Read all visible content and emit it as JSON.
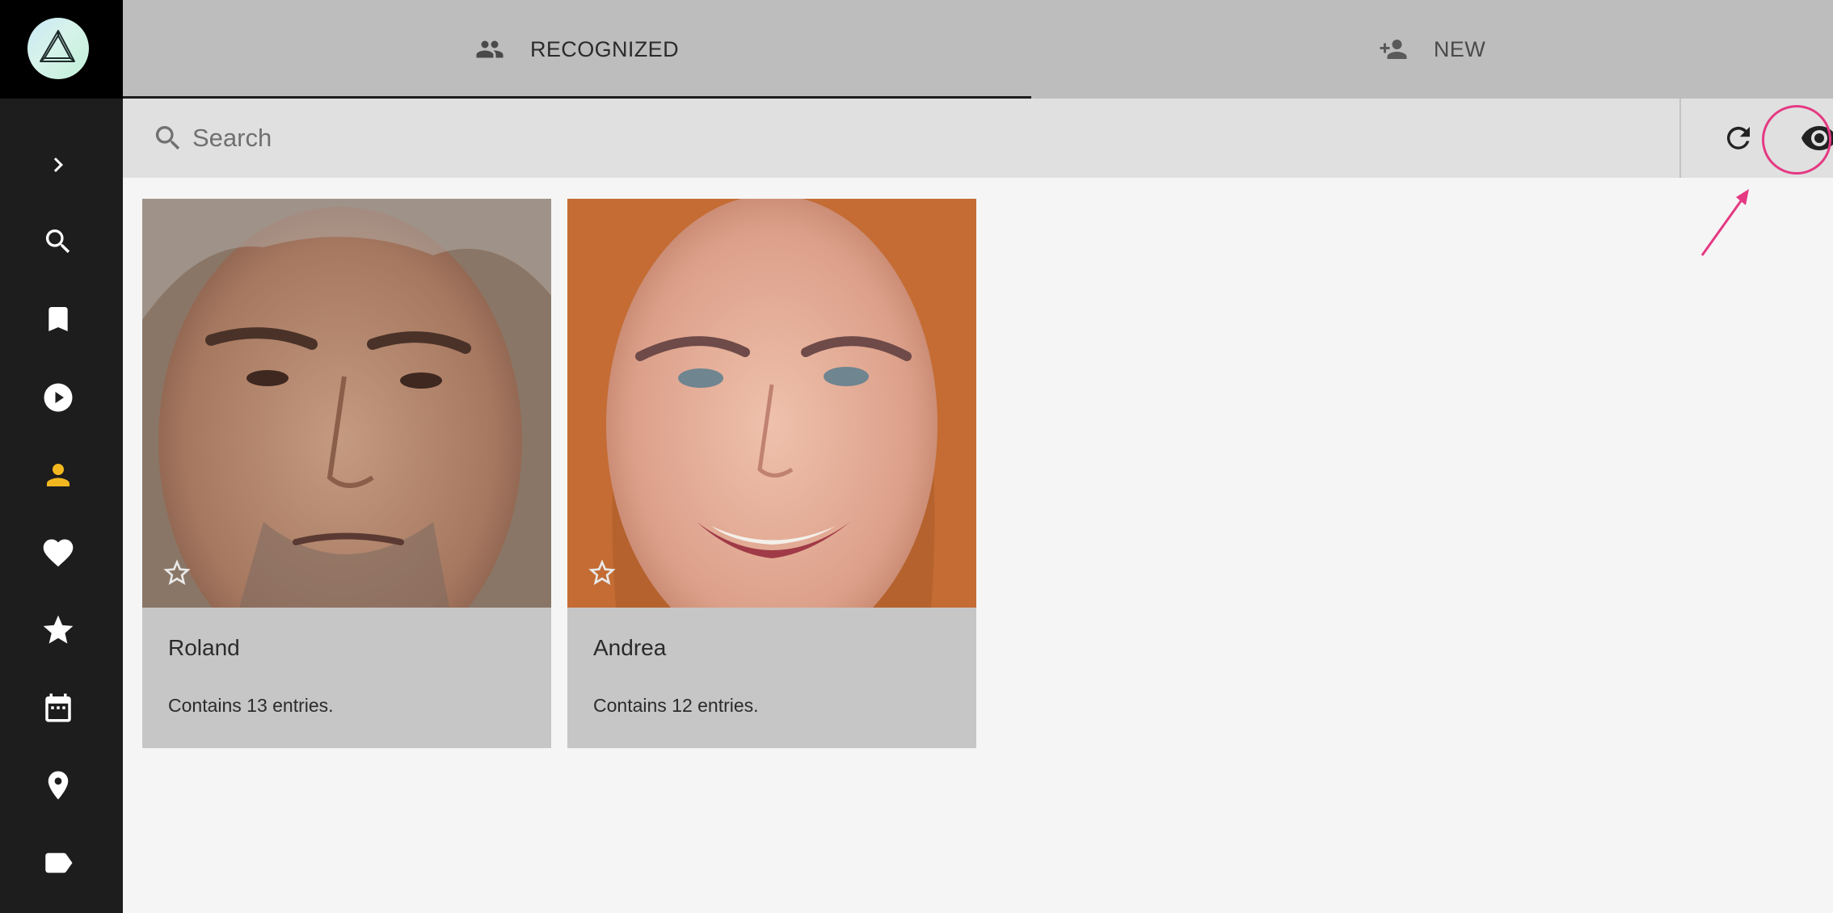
{
  "app": {
    "name": "PhotoPrism"
  },
  "sidebar": {
    "items": [
      {
        "id": "expand",
        "icon": "chevron-right-icon"
      },
      {
        "id": "search",
        "icon": "search-icon"
      },
      {
        "id": "albums",
        "icon": "bookmark-icon"
      },
      {
        "id": "videos",
        "icon": "play-circle-icon"
      },
      {
        "id": "people",
        "icon": "person-icon",
        "active": true
      },
      {
        "id": "favorites",
        "icon": "heart-icon"
      },
      {
        "id": "moments",
        "icon": "star-icon"
      },
      {
        "id": "calendar",
        "icon": "calendar-icon"
      },
      {
        "id": "places",
        "icon": "map-pin-icon"
      },
      {
        "id": "labels",
        "icon": "label-icon"
      }
    ],
    "active_color": "#f3b820"
  },
  "tabs": [
    {
      "label": "RECOGNIZED",
      "icon": "people-icon",
      "active": true
    },
    {
      "label": "NEW",
      "icon": "person-add-icon",
      "active": false
    }
  ],
  "search": {
    "placeholder": "Search",
    "value": ""
  },
  "toolbar": {
    "refresh_icon": "refresh-icon",
    "show_hidden_icon": "eye-icon",
    "highlight_color": "#e53982"
  },
  "people": [
    {
      "name": "Roland",
      "description": "Contains 13 entries."
    },
    {
      "name": "Andrea",
      "description": "Contains 12 entries."
    }
  ]
}
